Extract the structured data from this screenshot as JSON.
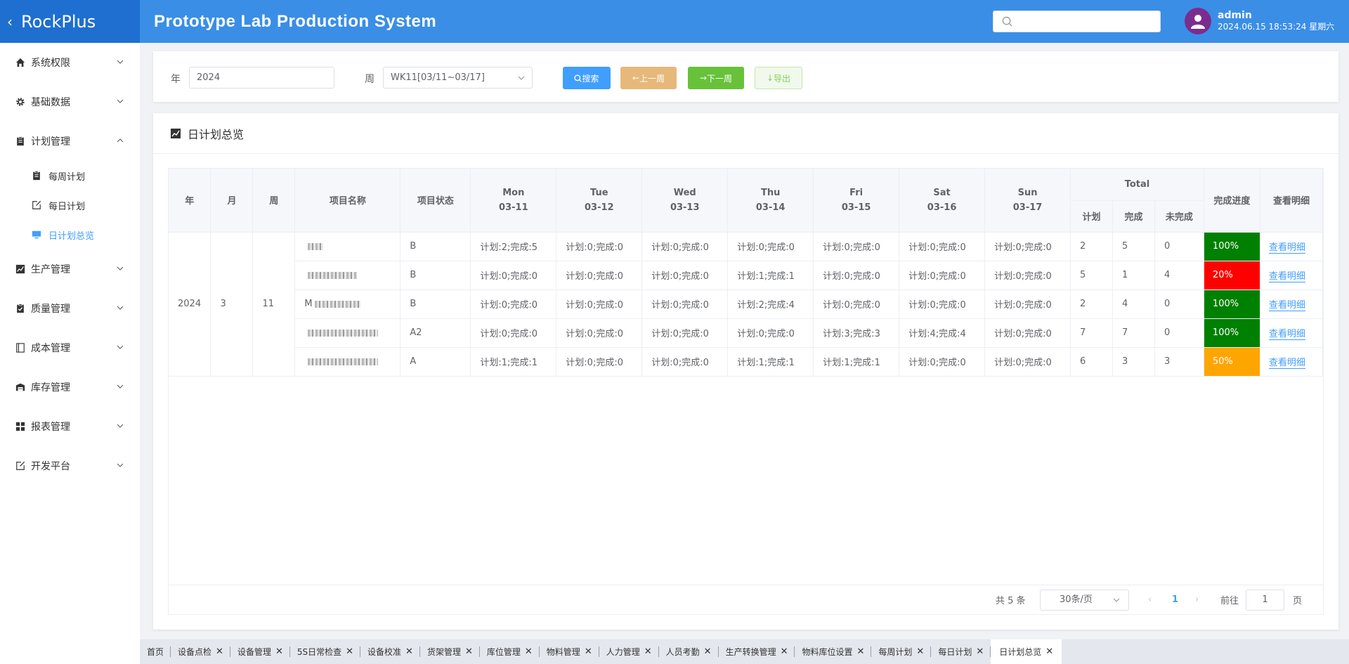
{
  "header": {
    "brand": "RockPlus",
    "title": "Prototype Lab Production System",
    "user": {
      "name": "admin",
      "datetime": "2024.06.15 18:53:24 星期六"
    }
  },
  "sidebar": {
    "items": [
      {
        "label": "系统权限",
        "icon": "home-icon",
        "expanded": false
      },
      {
        "label": "基础数据",
        "icon": "gear-icon",
        "expanded": false
      },
      {
        "label": "计划管理",
        "icon": "clipboard-icon",
        "expanded": true,
        "children": [
          {
            "label": "每周计划",
            "icon": "clipboard-icon",
            "active": false
          },
          {
            "label": "每日计划",
            "icon": "edit-icon",
            "active": false
          },
          {
            "label": "日计划总览",
            "icon": "monitor-icon",
            "active": true
          }
        ]
      },
      {
        "label": "生产管理",
        "icon": "chart-icon",
        "expanded": false
      },
      {
        "label": "质量管理",
        "icon": "check-clipboard-icon",
        "expanded": false
      },
      {
        "label": "成本管理",
        "icon": "notebook-icon",
        "expanded": false
      },
      {
        "label": "库存管理",
        "icon": "warehouse-icon",
        "expanded": false
      },
      {
        "label": "报表管理",
        "icon": "grid-icon",
        "expanded": false
      },
      {
        "label": "开发平台",
        "icon": "edit-icon",
        "expanded": false
      }
    ]
  },
  "filter": {
    "year_label": "年",
    "year_value": "2024",
    "week_label": "周",
    "week_value": "WK11[03/11~03/17]",
    "search_btn": "搜索",
    "prev_btn": "上一周",
    "next_btn": "下一周",
    "export_btn": "导出"
  },
  "panel": {
    "title": "日计划总览"
  },
  "table": {
    "headers": {
      "year": "年",
      "month": "月",
      "week": "周",
      "project": "项目名称",
      "status": "项目状态",
      "days": [
        {
          "day": "Mon",
          "date": "03-11"
        },
        {
          "day": "Tue",
          "date": "03-12"
        },
        {
          "day": "Wed",
          "date": "03-13"
        },
        {
          "day": "Thu",
          "date": "03-14"
        },
        {
          "day": "Fri",
          "date": "03-15"
        },
        {
          "day": "Sat",
          "date": "03-16"
        },
        {
          "day": "Sun",
          "date": "03-17"
        }
      ],
      "total": "Total",
      "plan": "计划",
      "done": "完成",
      "undone": "未完成",
      "progress": "完成进度",
      "detail": "查看明细"
    },
    "group": {
      "year": "2024",
      "month": "3",
      "week": "11"
    },
    "rows": [
      {
        "name_prefix": "",
        "status": "B",
        "days": [
          "计划:2;完成:5",
          "计划:0;完成:0",
          "计划:0;完成:0",
          "计划:0;完成:0",
          "计划:0;完成:0",
          "计划:0;完成:0",
          "计划:0;完成:0"
        ],
        "plan": "2",
        "done": "5",
        "undone": "0",
        "progress": "100%",
        "progress_color": "#008000",
        "detail": "查看明细"
      },
      {
        "name_prefix": "",
        "status": "B",
        "days": [
          "计划:0;完成:0",
          "计划:0;完成:0",
          "计划:0;完成:0",
          "计划:1;完成:1",
          "计划:0;完成:0",
          "计划:0;完成:0",
          "计划:0;完成:0"
        ],
        "plan": "5",
        "done": "1",
        "undone": "4",
        "progress": "20%",
        "progress_color": "#ff0000",
        "detail": "查看明细"
      },
      {
        "name_prefix": "M",
        "status": "B",
        "days": [
          "计划:0;完成:0",
          "计划:0;完成:0",
          "计划:0;完成:0",
          "计划:2;完成:4",
          "计划:0;完成:0",
          "计划:0;完成:0",
          "计划:0;完成:0"
        ],
        "plan": "2",
        "done": "4",
        "undone": "0",
        "progress": "100%",
        "progress_color": "#008000",
        "detail": "查看明细"
      },
      {
        "name_prefix": "",
        "status": "A2",
        "days": [
          "计划:0;完成:0",
          "计划:0;完成:0",
          "计划:0;完成:0",
          "计划:0;完成:0",
          "计划:3;完成:3",
          "计划:4;完成:4",
          "计划:0;完成:0"
        ],
        "plan": "7",
        "done": "7",
        "undone": "0",
        "progress": "100%",
        "progress_color": "#008000",
        "detail": "查看明细"
      },
      {
        "name_prefix": "",
        "status": "A",
        "days": [
          "计划:1;完成:1",
          "计划:0;完成:0",
          "计划:0;完成:0",
          "计划:1;完成:1",
          "计划:1;完成:1",
          "计划:0;完成:0",
          "计划:0;完成:0"
        ],
        "plan": "6",
        "done": "3",
        "undone": "3",
        "progress": "50%",
        "progress_color": "#ffa500",
        "detail": "查看明细"
      }
    ]
  },
  "pager": {
    "total": "共 5 条",
    "page_size": "30条/页",
    "current": "1",
    "goto_label": "前往",
    "goto_value": "1",
    "page_suffix": "页"
  },
  "tabs": [
    {
      "label": "首页",
      "closable": false,
      "active": false
    },
    {
      "label": "设备点检",
      "closable": true,
      "active": false
    },
    {
      "label": "设备管理",
      "closable": true,
      "active": false
    },
    {
      "label": "5S日常检查",
      "closable": true,
      "active": false
    },
    {
      "label": "设备校准",
      "closable": true,
      "active": false
    },
    {
      "label": "货架管理",
      "closable": true,
      "active": false
    },
    {
      "label": "库位管理",
      "closable": true,
      "active": false
    },
    {
      "label": "物料管理",
      "closable": true,
      "active": false
    },
    {
      "label": "人力管理",
      "closable": true,
      "active": false
    },
    {
      "label": "人员考勤",
      "closable": true,
      "active": false
    },
    {
      "label": "生产转换管理",
      "closable": true,
      "active": false
    },
    {
      "label": "物料库位设置",
      "closable": true,
      "active": false
    },
    {
      "label": "每周计划",
      "closable": true,
      "active": false
    },
    {
      "label": "每日计划",
      "closable": true,
      "active": false
    },
    {
      "label": "日计划总览",
      "closable": true,
      "active": true
    }
  ]
}
